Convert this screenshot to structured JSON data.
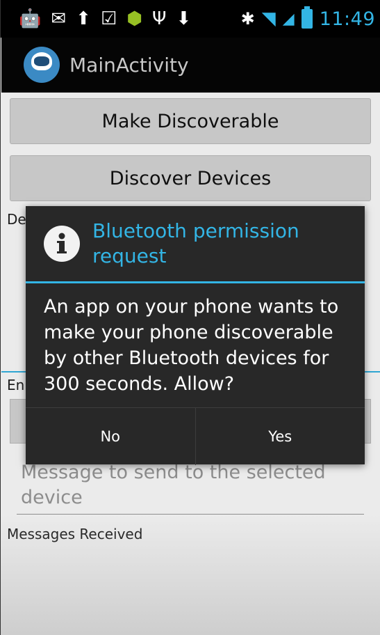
{
  "status_bar": {
    "icons_left": [
      "android-icon",
      "gmail-icon",
      "usb-debug-icon",
      "tasks-icon",
      "bugdroid-icon",
      "usb-icon",
      "download-icon"
    ],
    "icons_right": [
      "bluetooth-icon",
      "wifi-icon",
      "signal-icon",
      "battery-icon"
    ],
    "time": "11:49"
  },
  "action_bar": {
    "title": "MainActivity"
  },
  "main": {
    "make_discoverable_label": "Make Discoverable",
    "discover_devices_label": "Discover Devices",
    "devices_label": "De",
    "enter_label": "En",
    "message_placeholder": "Message to send to the selected device",
    "messages_received_label": "Messages Received"
  },
  "dialog": {
    "title": "Bluetooth permission request",
    "message": "An app on your phone wants to make your phone discoverable by other Bluetooth devices for 300 seconds. Allow?",
    "no_label": "No",
    "yes_label": "Yes"
  },
  "colors": {
    "accent": "#33b5e5",
    "dialog_bg": "#282828",
    "status_bar_bg": "#000000"
  }
}
